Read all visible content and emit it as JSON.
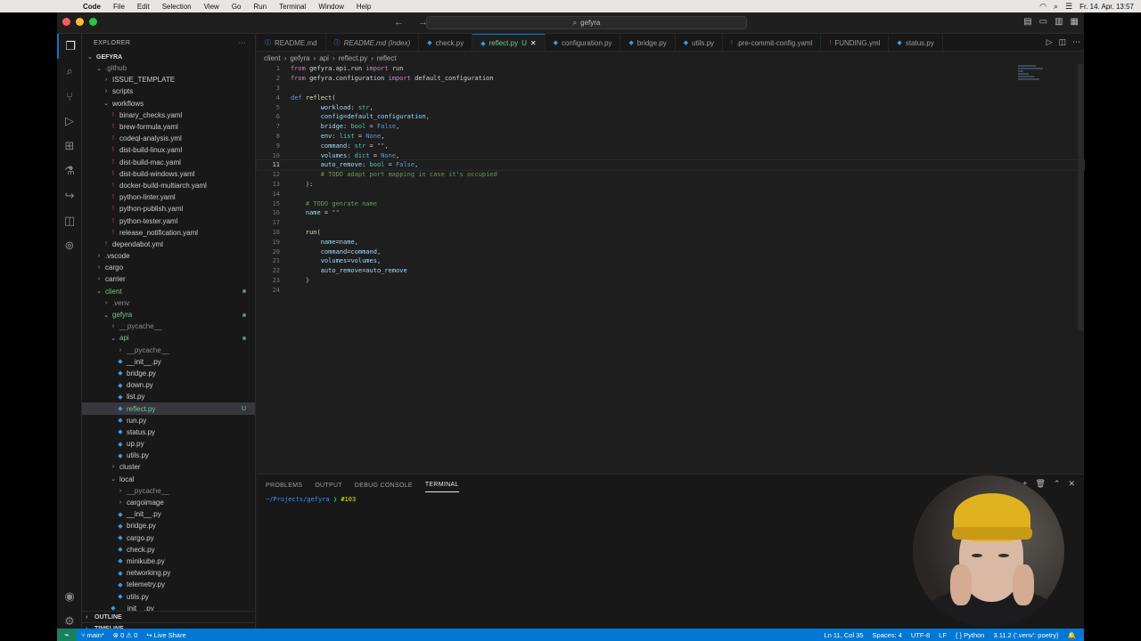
{
  "macos": {
    "apple_icon": "apple-icon",
    "menu": [
      "Code",
      "File",
      "Edit",
      "Selection",
      "View",
      "Go",
      "Run",
      "Terminal",
      "Window",
      "Help"
    ],
    "datetime": "Fr. 14. Apr. 13:57"
  },
  "titlebar": {
    "search_text": "gefyra"
  },
  "sidebar": {
    "title": "EXPLORER",
    "more": "···",
    "project": "GEFYRA",
    "tree": [
      {
        "label": ".github",
        "depth": 1,
        "kind": "folder-open",
        "state": "dim"
      },
      {
        "label": "ISSUE_TEMPLATE",
        "depth": 2,
        "kind": "folder"
      },
      {
        "label": "scripts",
        "depth": 2,
        "kind": "folder"
      },
      {
        "label": "workflows",
        "depth": 2,
        "kind": "folder-open"
      },
      {
        "label": "binary_checks.yaml",
        "depth": 3,
        "kind": "yaml"
      },
      {
        "label": "brew-formula.yaml",
        "depth": 3,
        "kind": "yaml"
      },
      {
        "label": "codeql-analysis.yml",
        "depth": 3,
        "kind": "yaml"
      },
      {
        "label": "dist-build-linux.yaml",
        "depth": 3,
        "kind": "yaml"
      },
      {
        "label": "dist-build-mac.yaml",
        "depth": 3,
        "kind": "yaml"
      },
      {
        "label": "dist-build-windows.yaml",
        "depth": 3,
        "kind": "yaml"
      },
      {
        "label": "docker-build-multiarch.yaml",
        "depth": 3,
        "kind": "yaml"
      },
      {
        "label": "python-linter.yaml",
        "depth": 3,
        "kind": "yaml"
      },
      {
        "label": "python-publish.yaml",
        "depth": 3,
        "kind": "yaml"
      },
      {
        "label": "python-tester.yaml",
        "depth": 3,
        "kind": "yaml"
      },
      {
        "label": "release_notification.yaml",
        "depth": 3,
        "kind": "yaml"
      },
      {
        "label": "dependabot.yml",
        "depth": 2,
        "kind": "yaml"
      },
      {
        "label": ".vscode",
        "depth": 1,
        "kind": "folder"
      },
      {
        "label": "cargo",
        "depth": 1,
        "kind": "folder"
      },
      {
        "label": "carrier",
        "depth": 1,
        "kind": "folder"
      },
      {
        "label": "client",
        "depth": 1,
        "kind": "folder-open",
        "state": "mod",
        "dot": true
      },
      {
        "label": ".venv",
        "depth": 2,
        "kind": "folder",
        "state": "dim"
      },
      {
        "label": "gefyra",
        "depth": 2,
        "kind": "folder-open",
        "state": "mod",
        "dot": true
      },
      {
        "label": "__pycache__",
        "depth": 3,
        "kind": "folder",
        "state": "dim"
      },
      {
        "label": "api",
        "depth": 3,
        "kind": "folder-open",
        "state": "mod",
        "dot": true
      },
      {
        "label": "__pycache__",
        "depth": 4,
        "kind": "folder",
        "state": "dim"
      },
      {
        "label": "__init__.py",
        "depth": 4,
        "kind": "py"
      },
      {
        "label": "bridge.py",
        "depth": 4,
        "kind": "py"
      },
      {
        "label": "down.py",
        "depth": 4,
        "kind": "py"
      },
      {
        "label": "list.py",
        "depth": 4,
        "kind": "py"
      },
      {
        "label": "reflect.py",
        "depth": 4,
        "kind": "py",
        "state": "mod",
        "selected": true,
        "badge": "U"
      },
      {
        "label": "run.py",
        "depth": 4,
        "kind": "py"
      },
      {
        "label": "status.py",
        "depth": 4,
        "kind": "py"
      },
      {
        "label": "up.py",
        "depth": 4,
        "kind": "py"
      },
      {
        "label": "utils.py",
        "depth": 4,
        "kind": "py"
      },
      {
        "label": "cluster",
        "depth": 3,
        "kind": "folder"
      },
      {
        "label": "local",
        "depth": 3,
        "kind": "folder-open"
      },
      {
        "label": "__pycache__",
        "depth": 4,
        "kind": "folder",
        "state": "dim"
      },
      {
        "label": "cargoimage",
        "depth": 4,
        "kind": "folder"
      },
      {
        "label": "__init__.py",
        "depth": 4,
        "kind": "py"
      },
      {
        "label": "bridge.py",
        "depth": 4,
        "kind": "py"
      },
      {
        "label": "cargo.py",
        "depth": 4,
        "kind": "py"
      },
      {
        "label": "check.py",
        "depth": 4,
        "kind": "py"
      },
      {
        "label": "minikube.py",
        "depth": 4,
        "kind": "py"
      },
      {
        "label": "networking.py",
        "depth": 4,
        "kind": "py"
      },
      {
        "label": "telemetry.py",
        "depth": 4,
        "kind": "py"
      },
      {
        "label": "utils.py",
        "depth": 4,
        "kind": "py"
      },
      {
        "label": "__init__.py",
        "depth": 3,
        "kind": "py"
      }
    ],
    "outline": "OUTLINE",
    "timeline": "TIMELINE"
  },
  "tabs": [
    {
      "label": "README.md",
      "icon": "info-icon"
    },
    {
      "label": "README.md (Index)",
      "icon": "info-icon",
      "italic": true
    },
    {
      "label": "check.py",
      "icon": "python-icon"
    },
    {
      "label": "reflect.py",
      "icon": "python-icon",
      "active": true,
      "suffix": "U",
      "modified": true
    },
    {
      "label": "configuration.py",
      "icon": "python-icon"
    },
    {
      "label": "bridge.py",
      "icon": "python-icon"
    },
    {
      "label": "utils.py",
      "icon": "python-icon"
    },
    {
      "label": ".pre-commit-config.yaml",
      "icon": "yaml-icon"
    },
    {
      "label": "FUNDING.yml",
      "icon": "yaml-icon"
    },
    {
      "label": "status.py",
      "icon": "python-icon"
    }
  ],
  "breadcrumb": [
    "client",
    "gefyra",
    "api",
    "reflect.py",
    "reflect"
  ],
  "code": [
    [
      [
        "kw",
        "from "
      ],
      [
        "nm",
        "gefyra.api.run "
      ],
      [
        "kw",
        "import "
      ],
      [
        "nm",
        "run"
      ]
    ],
    [
      [
        "kw",
        "from "
      ],
      [
        "nm",
        "gefyra.configuration "
      ],
      [
        "kw",
        "import "
      ],
      [
        "nm",
        "default_configuration"
      ]
    ],
    [],
    [
      [
        "kd",
        "def "
      ],
      [
        "fn",
        "reflect"
      ],
      [
        "nm",
        "("
      ]
    ],
    [
      [
        "nm",
        "        "
      ],
      [
        "pm",
        "workload"
      ],
      [
        "nm",
        ": "
      ],
      [
        "ty",
        "str"
      ],
      [
        "nm",
        ","
      ]
    ],
    [
      [
        "nm",
        "        "
      ],
      [
        "pm",
        "config"
      ],
      [
        "nm",
        "="
      ],
      [
        "pm",
        "default_configuration"
      ],
      [
        "nm",
        ","
      ]
    ],
    [
      [
        "nm",
        "        "
      ],
      [
        "pm",
        "bridge"
      ],
      [
        "nm",
        ": "
      ],
      [
        "ty",
        "bool"
      ],
      [
        "nm",
        " = "
      ],
      [
        "cst",
        "False"
      ],
      [
        "nm",
        ","
      ]
    ],
    [
      [
        "nm",
        "        "
      ],
      [
        "pm",
        "env"
      ],
      [
        "nm",
        ": "
      ],
      [
        "ty",
        "list"
      ],
      [
        "nm",
        " = "
      ],
      [
        "cst",
        "None"
      ],
      [
        "nm",
        ","
      ]
    ],
    [
      [
        "nm",
        "        "
      ],
      [
        "pm",
        "command"
      ],
      [
        "nm",
        ": "
      ],
      [
        "ty",
        "str"
      ],
      [
        "nm",
        " = "
      ],
      [
        "st",
        "\"\""
      ],
      [
        "nm",
        ","
      ]
    ],
    [
      [
        "nm",
        "        "
      ],
      [
        "pm",
        "volumes"
      ],
      [
        "nm",
        ": "
      ],
      [
        "ty",
        "dict"
      ],
      [
        "nm",
        " = "
      ],
      [
        "cst",
        "None"
      ],
      [
        "nm",
        ","
      ]
    ],
    [
      [
        "nm",
        "        "
      ],
      [
        "pm",
        "auto_remove"
      ],
      [
        "nm",
        ": "
      ],
      [
        "ty",
        "bool"
      ],
      [
        "nm",
        " = "
      ],
      [
        "cst",
        "False"
      ],
      [
        "nm",
        ","
      ]
    ],
    [
      [
        "nm",
        "        "
      ],
      [
        "cm",
        "# TODO adapt port mapping in case it's occupied"
      ]
    ],
    [
      [
        "nm",
        "    ):"
      ]
    ],
    [],
    [
      [
        "nm",
        "    "
      ],
      [
        "cm",
        "# TODO genrate name"
      ]
    ],
    [
      [
        "nm",
        "    "
      ],
      [
        "pm",
        "name"
      ],
      [
        "nm",
        " = "
      ],
      [
        "st",
        "\"\""
      ]
    ],
    [],
    [
      [
        "nm",
        "    "
      ],
      [
        "fn",
        "run"
      ],
      [
        "nm",
        "("
      ]
    ],
    [
      [
        "nm",
        "        "
      ],
      [
        "pm",
        "name"
      ],
      [
        "nm",
        "="
      ],
      [
        "pm",
        "name"
      ],
      [
        "nm",
        ","
      ]
    ],
    [
      [
        "nm",
        "        "
      ],
      [
        "pm",
        "command"
      ],
      [
        "nm",
        "="
      ],
      [
        "pm",
        "command"
      ],
      [
        "nm",
        ","
      ]
    ],
    [
      [
        "nm",
        "        "
      ],
      [
        "pm",
        "volumes"
      ],
      [
        "nm",
        "="
      ],
      [
        "pm",
        "volumes"
      ],
      [
        "nm",
        ","
      ]
    ],
    [
      [
        "nm",
        "        "
      ],
      [
        "pm",
        "auto_remove"
      ],
      [
        "nm",
        "="
      ],
      [
        "pm",
        "auto_remove"
      ]
    ],
    [
      [
        "nm",
        "    )"
      ]
    ],
    []
  ],
  "current_line": 11,
  "panel": {
    "tabs": [
      "PROBLEMS",
      "OUTPUT",
      "DEBUG CONSOLE",
      "TERMINAL"
    ],
    "active": "TERMINAL",
    "prompt_path": "~/Projects/gefyra",
    "prompt_branch": "#103"
  },
  "statusbar": {
    "branch": "main*",
    "errors": "0",
    "warnings": "0",
    "live_share": "Live Share",
    "position": "Ln 11, Col 35",
    "spaces": "Spaces: 4",
    "encoding": "UTF-8",
    "eol": "LF",
    "language": "Python",
    "interpreter": "3.11.2 ('.venv': poetry)"
  },
  "colors": {
    "accent": "#0078d4",
    "git_untracked": "#73c991",
    "editor_bg": "#1e1e1e",
    "sidebar_bg": "#181818"
  }
}
